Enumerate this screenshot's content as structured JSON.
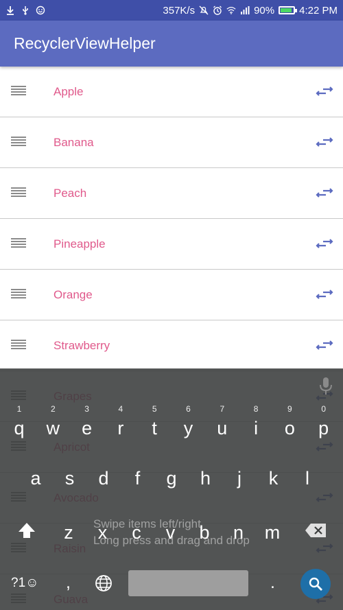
{
  "status_bar": {
    "left_icons": [
      "download-icon",
      "usb-icon",
      "emoji-icon"
    ],
    "network_speed": "357K/s",
    "battery_percent": "90%",
    "battery_level": 0.9,
    "time": "4:22 PM"
  },
  "app_bar": {
    "title": "RecyclerViewHelper"
  },
  "list": {
    "items": [
      {
        "label": "Apple"
      },
      {
        "label": "Banana"
      },
      {
        "label": "Peach"
      },
      {
        "label": "Pineapple"
      },
      {
        "label": "Orange"
      },
      {
        "label": "Strawberry"
      },
      {
        "label": "Grapes"
      },
      {
        "label": "Apricot"
      },
      {
        "label": "Avocado"
      },
      {
        "label": "Raisin"
      },
      {
        "label": "Guava"
      }
    ]
  },
  "snackbar": {
    "line1": "Swipe items left/right",
    "line2": "Long press and drag and drop"
  },
  "keyboard": {
    "row1": [
      {
        "key": "q",
        "hint": "1"
      },
      {
        "key": "w",
        "hint": "2"
      },
      {
        "key": "e",
        "hint": "3"
      },
      {
        "key": "r",
        "hint": "4"
      },
      {
        "key": "t",
        "hint": "5"
      },
      {
        "key": "y",
        "hint": "6"
      },
      {
        "key": "u",
        "hint": "7"
      },
      {
        "key": "i",
        "hint": "8"
      },
      {
        "key": "o",
        "hint": "9"
      },
      {
        "key": "p",
        "hint": "0"
      }
    ],
    "row2": [
      "a",
      "s",
      "d",
      "f",
      "g",
      "h",
      "j",
      "k",
      "l"
    ],
    "row3": [
      "z",
      "x",
      "c",
      "v",
      "b",
      "n",
      "m"
    ],
    "symbols_label": "?1☺",
    "comma": ",",
    "period": "."
  },
  "colors": {
    "status_bar": "#3f4fa8",
    "app_bar": "#5c6bc0",
    "item_text": "#e0598b",
    "swap_icon": "#5c6bc0",
    "search_key": "#1e6fa8"
  }
}
